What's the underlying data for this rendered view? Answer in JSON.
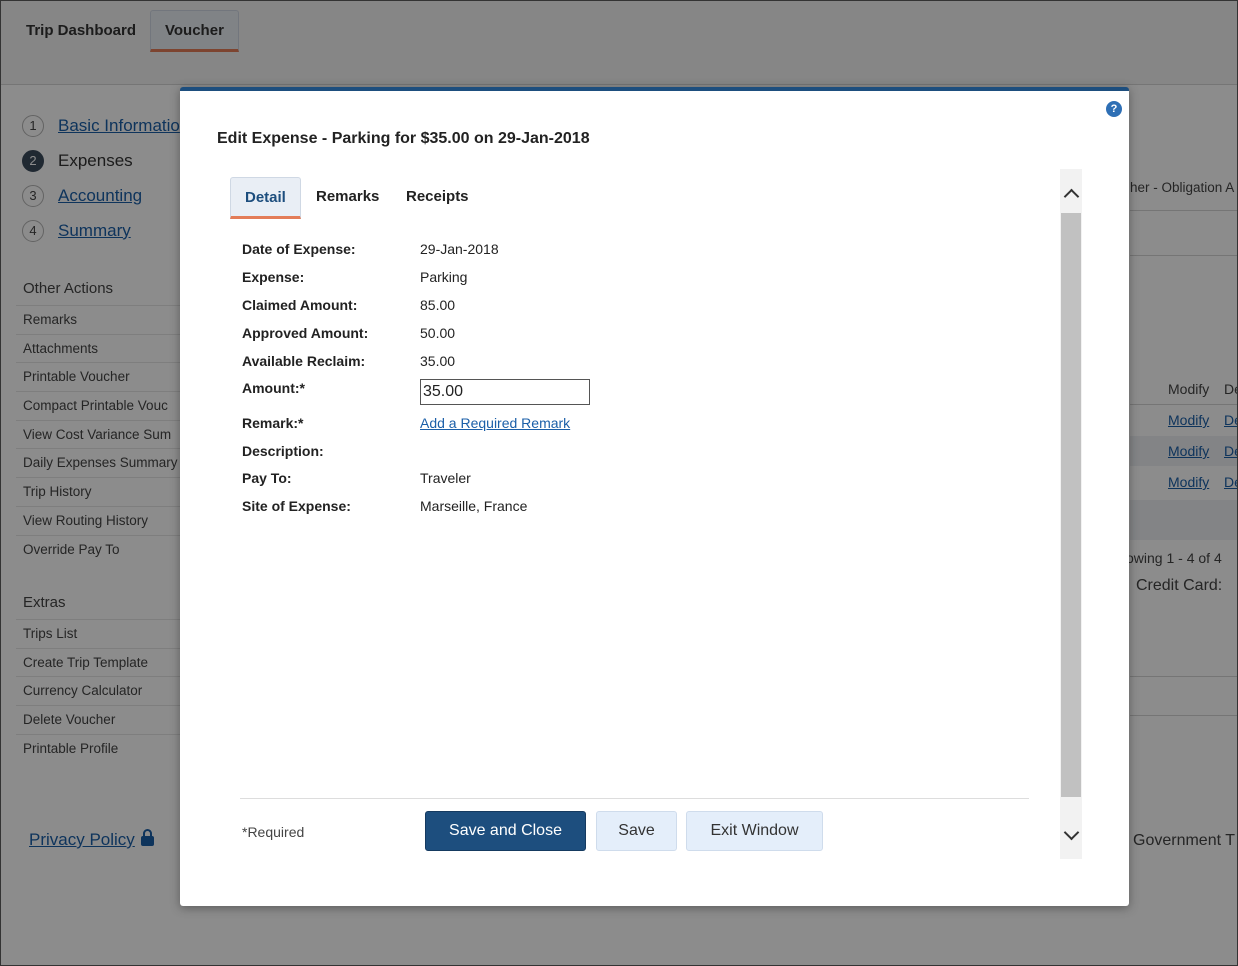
{
  "topnav": {
    "tab1": "Trip Dashboard",
    "tab2": "Voucher"
  },
  "steps": [
    {
      "num": "1",
      "label": "Basic Informatio"
    },
    {
      "num": "2",
      "label": "Expenses"
    },
    {
      "num": "3",
      "label": "Accounting"
    },
    {
      "num": "4",
      "label": "Summary"
    }
  ],
  "other_actions": {
    "title": "Other Actions",
    "items": [
      "Remarks",
      "Attachments",
      "Printable Voucher",
      "Compact Printable Vouc",
      "View Cost Variance Sum",
      "Daily Expenses Summary",
      "Trip History",
      "View Routing History",
      "Override Pay To"
    ]
  },
  "extras": {
    "title": "Extras",
    "items": [
      "Trips List",
      "Create Trip Template",
      "Currency Calculator",
      "Delete Voucher",
      "Printable Profile"
    ]
  },
  "privacy": "Privacy Policy",
  "background_right": {
    "obligation": "her - Obligation A",
    "modify_header": "Modify",
    "col2_header": "De",
    "modify_links": [
      "Modify",
      "Modify",
      "Modify"
    ],
    "col2_links": [
      "De",
      "De",
      "De"
    ],
    "showing": "owing 1 - 4 of 4",
    "credit": "Credit Card:",
    "government": "Government T"
  },
  "modal": {
    "title": "Edit Expense - Parking for $35.00 on 29-Jan-2018",
    "tabs": [
      "Detail",
      "Remarks",
      "Receipts"
    ],
    "fields": {
      "date_label": "Date of Expense:",
      "date_value": "29-Jan-2018",
      "expense_label": "Expense:",
      "expense_value": "Parking",
      "claimed_label": "Claimed Amount:",
      "claimed_value": "85.00",
      "approved_label": "Approved Amount:",
      "approved_value": "50.00",
      "reclaim_label": "Available Reclaim:",
      "reclaim_value": "35.00",
      "amount_label": "Amount:*",
      "amount_value": "35.00",
      "remark_label": "Remark:*",
      "remark_link": "Add a Required Remark",
      "description_label": "Description:",
      "payto_label": "Pay To:",
      "payto_value": "Traveler",
      "site_label": "Site of Expense:",
      "site_value": "Marseille, France"
    },
    "required_note": "*Required",
    "buttons": {
      "save_close": "Save and Close",
      "save": "Save",
      "exit": "Exit Window"
    },
    "help_icon": "?"
  }
}
